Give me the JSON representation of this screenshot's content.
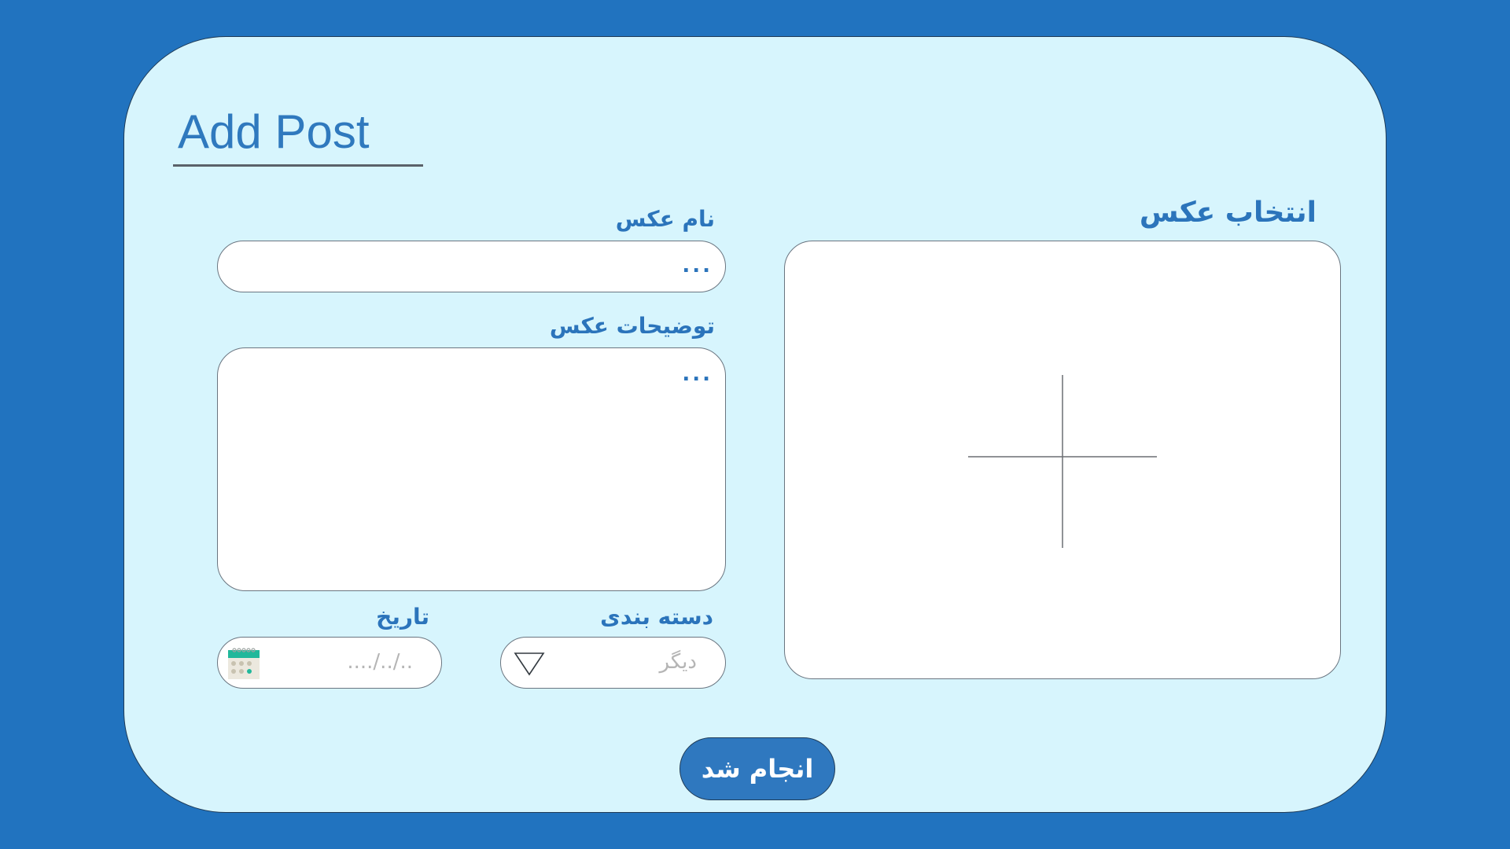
{
  "form": {
    "title": "Add Post",
    "image_name_label": "نام عکس",
    "image_name_placeholder": "...",
    "description_label": "توضیحات عکس",
    "description_placeholder": "...",
    "category_label": "دسته بندی",
    "category_selected": "دیگر",
    "date_label": "تاریخ",
    "date_placeholder": "..../../..",
    "select_image_label": "انتخاب عکس",
    "submit_label": "انجام شد"
  },
  "colors": {
    "background": "#2173bf",
    "card": "#d7f5fd",
    "accent": "#2b74bb",
    "button": "#2f78bf",
    "calendar_header": "#21b89b"
  },
  "icons": {
    "dropdown": "triangle-down-icon",
    "calendar": "calendar-icon",
    "add_image": "plus-icon"
  }
}
